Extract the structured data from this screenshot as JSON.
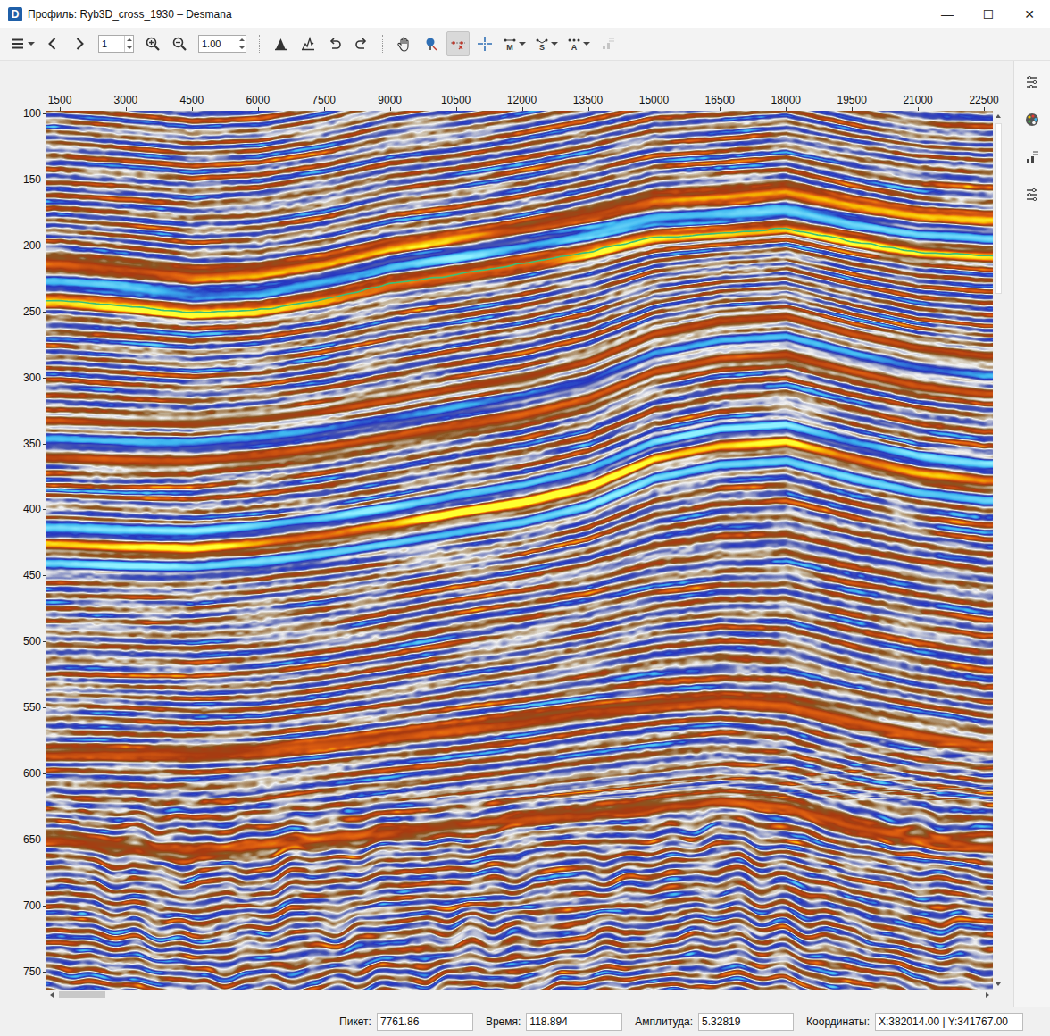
{
  "window": {
    "title": "Профиль: Ryb3D_cross_1930 – Desmana",
    "app_icon": "D",
    "controls": [
      "—",
      "☐",
      "✕"
    ]
  },
  "toolbar": [
    {
      "kind": "button",
      "dropdown": true,
      "selected": false,
      "disabled": false
    },
    {
      "kind": "button",
      "dropdown": false,
      "selected": false,
      "disabled": false
    },
    {
      "kind": "button",
      "dropdown": false,
      "selected": false,
      "disabled": false
    },
    {
      "kind": "spin",
      "value": "1"
    },
    {
      "kind": "button",
      "dropdown": false,
      "selected": false,
      "disabled": false
    },
    {
      "kind": "button",
      "dropdown": false,
      "selected": false,
      "disabled": false
    },
    {
      "kind": "spin",
      "value": "1.00"
    },
    {
      "kind": "separator"
    },
    {
      "kind": "button",
      "dropdown": false,
      "selected": false,
      "disabled": false
    },
    {
      "kind": "button",
      "dropdown": false,
      "selected": false,
      "disabled": false
    },
    {
      "kind": "button",
      "dropdown": false,
      "selected": false,
      "disabled": false
    },
    {
      "kind": "button",
      "dropdown": false,
      "selected": false,
      "disabled": false
    },
    {
      "kind": "separator"
    },
    {
      "kind": "button",
      "dropdown": false,
      "selected": false,
      "disabled": false
    },
    {
      "kind": "button",
      "dropdown": false,
      "selected": false,
      "disabled": false
    },
    {
      "kind": "button",
      "dropdown": false,
      "selected": true,
      "disabled": false
    },
    {
      "kind": "button",
      "dropdown": false,
      "selected": false,
      "disabled": false
    },
    {
      "kind": "lettered",
      "label": "M",
      "dropdown": true,
      "selected": false,
      "disabled": false
    },
    {
      "kind": "lettered",
      "label": "S",
      "dropdown": true,
      "selected": false,
      "disabled": false
    },
    {
      "kind": "lettered",
      "label": "A",
      "dropdown": true,
      "selected": false,
      "disabled": false
    },
    {
      "kind": "button",
      "dropdown": false,
      "selected": false,
      "disabled": true
    }
  ],
  "section": {
    "x_ticks": [
      "1500",
      "3000",
      "4500",
      "6000",
      "7500",
      "9000",
      "10500",
      "12000",
      "13500",
      "15000",
      "16500",
      "18000",
      "19500",
      "21000",
      "22500"
    ],
    "y_ticks": [
      "100",
      "150",
      "200",
      "250",
      "300",
      "350",
      "400",
      "450",
      "500",
      "550",
      "600",
      "650",
      "700",
      "750"
    ],
    "horizons": [
      {
        "amplitude": 0.8,
        "times": [
          214,
          218,
          223,
          221,
          213,
          201,
          194,
          186,
          177,
          166,
          163,
          159,
          169,
          177,
          180
        ]
      },
      {
        "amplitude": -0.9,
        "times": [
          228,
          232,
          237,
          235,
          227,
          215,
          208,
          200,
          191,
          180,
          177,
          173,
          183,
          191,
          194
        ]
      },
      {
        "amplitude": 1.0,
        "times": [
          242,
          246,
          251,
          249,
          241,
          229,
          222,
          214,
          205,
          194,
          191,
          187,
          197,
          205,
          208
        ]
      },
      {
        "amplitude": 0.5,
        "times": [
          332,
          334,
          335,
          331,
          325,
          317,
          308,
          300,
          288,
          267,
          257,
          254,
          267,
          278,
          284
        ]
      },
      {
        "amplitude": -0.7,
        "times": [
          347,
          349,
          350,
          346,
          340,
          332,
          323,
          315,
          303,
          282,
          272,
          269,
          282,
          293,
          299
        ]
      },
      {
        "amplitude": 0.6,
        "times": [
          361,
          363,
          364,
          360,
          354,
          346,
          337,
          329,
          317,
          296,
          286,
          283,
          296,
          307,
          313
        ]
      },
      {
        "amplitude": -0.9,
        "times": [
          414,
          416,
          417,
          413,
          407,
          399,
          390,
          382,
          370,
          349,
          339,
          336,
          349,
          360,
          366
        ]
      },
      {
        "amplitude": 1.0,
        "times": [
          427,
          429,
          430,
          426,
          420,
          412,
          403,
          395,
          383,
          362,
          352,
          349,
          362,
          373,
          379
        ]
      },
      {
        "amplitude": -0.85,
        "times": [
          441,
          443,
          444,
          440,
          434,
          426,
          417,
          409,
          397,
          376,
          366,
          363,
          376,
          387,
          393
        ]
      },
      {
        "amplitude": 0.7,
        "times": [
          585,
          585,
          585,
          583,
          578,
          572,
          566,
          560,
          553,
          548,
          545,
          548,
          560,
          570,
          578
        ]
      },
      {
        "amplitude": 0.6,
        "times": [
          650,
          655,
          660,
          655,
          650,
          645,
          640,
          635,
          630,
          625,
          620,
          625,
          640,
          650,
          655
        ]
      }
    ],
    "picked_horizon": {
      "times": [
        242,
        246,
        251,
        249,
        241,
        229,
        222,
        214,
        205,
        194,
        191,
        187,
        197,
        205,
        208
      ]
    }
  },
  "scrollbars": {
    "horizontal": {
      "position": 0.0,
      "size": 0.05
    },
    "vertical": {
      "position": 0.0,
      "size": 0.2
    }
  },
  "status_bar": [
    {
      "label": "Пикет:",
      "value": "7761.86"
    },
    {
      "label": "Время:",
      "value": "118.894"
    },
    {
      "label": "Амплитуда:",
      "value": "5.32819"
    },
    {
      "label": "Координаты:",
      "value": "X:382014.00 | Y:341767.00"
    }
  ]
}
